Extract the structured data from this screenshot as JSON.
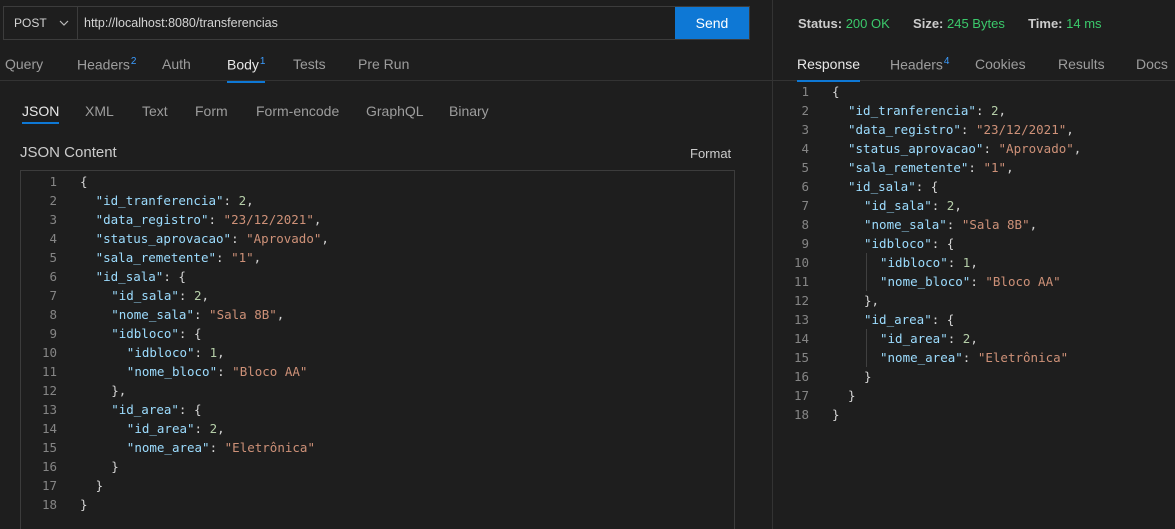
{
  "request": {
    "method": "POST",
    "url": "http://localhost:8080/transferencias",
    "send_label": "Send",
    "tabs": [
      {
        "label": "Query",
        "badge": ""
      },
      {
        "label": "Headers",
        "badge": "2"
      },
      {
        "label": "Auth",
        "badge": ""
      },
      {
        "label": "Body",
        "badge": "1"
      },
      {
        "label": "Tests",
        "badge": ""
      },
      {
        "label": "Pre Run",
        "badge": ""
      }
    ],
    "active_tab": "Body",
    "body_types": [
      "JSON",
      "XML",
      "Text",
      "Form",
      "Form-encode",
      "GraphQL",
      "Binary"
    ],
    "active_body_type": "JSON",
    "content_title": "JSON Content",
    "format_label": "Format"
  },
  "response": {
    "status_label": "Status:",
    "status_value": "200 OK",
    "size_label": "Size:",
    "size_value": "245 Bytes",
    "time_label": "Time:",
    "time_value": "14 ms",
    "tabs": [
      {
        "label": "Response",
        "badge": ""
      },
      {
        "label": "Headers",
        "badge": "4"
      },
      {
        "label": "Cookies",
        "badge": ""
      },
      {
        "label": "Results",
        "badge": ""
      },
      {
        "label": "Docs",
        "badge": ""
      }
    ],
    "active_tab": "Response"
  },
  "json_lines": [
    {
      "indent": 0,
      "parts": [
        [
          "p",
          "{"
        ]
      ]
    },
    {
      "indent": 1,
      "parts": [
        [
          "k",
          "\"id_tranferencia\""
        ],
        [
          "p",
          ": "
        ],
        [
          "n",
          "2"
        ],
        [
          "p",
          ","
        ]
      ]
    },
    {
      "indent": 1,
      "parts": [
        [
          "k",
          "\"data_registro\""
        ],
        [
          "p",
          ": "
        ],
        [
          "s",
          "\"23/12/2021\""
        ],
        [
          "p",
          ","
        ]
      ]
    },
    {
      "indent": 1,
      "parts": [
        [
          "k",
          "\"status_aprovacao\""
        ],
        [
          "p",
          ": "
        ],
        [
          "s",
          "\"Aprovado\""
        ],
        [
          "p",
          ","
        ]
      ]
    },
    {
      "indent": 1,
      "parts": [
        [
          "k",
          "\"sala_remetente\""
        ],
        [
          "p",
          ": "
        ],
        [
          "s",
          "\"1\""
        ],
        [
          "p",
          ","
        ]
      ]
    },
    {
      "indent": 1,
      "parts": [
        [
          "k",
          "\"id_sala\""
        ],
        [
          "p",
          ": {"
        ]
      ]
    },
    {
      "indent": 2,
      "parts": [
        [
          "k",
          "\"id_sala\""
        ],
        [
          "p",
          ": "
        ],
        [
          "n",
          "2"
        ],
        [
          "p",
          ","
        ]
      ]
    },
    {
      "indent": 2,
      "parts": [
        [
          "k",
          "\"nome_sala\""
        ],
        [
          "p",
          ": "
        ],
        [
          "s",
          "\"Sala 8B\""
        ],
        [
          "p",
          ","
        ]
      ]
    },
    {
      "indent": 2,
      "parts": [
        [
          "k",
          "\"idbloco\""
        ],
        [
          "p",
          ": {"
        ]
      ]
    },
    {
      "indent": 3,
      "parts": [
        [
          "k",
          "\"idbloco\""
        ],
        [
          "p",
          ": "
        ],
        [
          "n",
          "1"
        ],
        [
          "p",
          ","
        ]
      ]
    },
    {
      "indent": 3,
      "parts": [
        [
          "k",
          "\"nome_bloco\""
        ],
        [
          "p",
          ": "
        ],
        [
          "s",
          "\"Bloco AA\""
        ]
      ]
    },
    {
      "indent": 2,
      "parts": [
        [
          "p",
          "},"
        ]
      ]
    },
    {
      "indent": 2,
      "parts": [
        [
          "k",
          "\"id_area\""
        ],
        [
          "p",
          ": {"
        ]
      ]
    },
    {
      "indent": 3,
      "parts": [
        [
          "k",
          "\"id_area\""
        ],
        [
          "p",
          ": "
        ],
        [
          "n",
          "2"
        ],
        [
          "p",
          ","
        ]
      ]
    },
    {
      "indent": 3,
      "parts": [
        [
          "k",
          "\"nome_area\""
        ],
        [
          "p",
          ": "
        ],
        [
          "s",
          "\"Eletrônica\""
        ]
      ]
    },
    {
      "indent": 2,
      "parts": [
        [
          "p",
          "}"
        ]
      ]
    },
    {
      "indent": 1,
      "parts": [
        [
          "p",
          "}"
        ]
      ]
    },
    {
      "indent": 0,
      "parts": [
        [
          "p",
          "}"
        ]
      ]
    }
  ],
  "colors": {
    "accent": "#0e78d5",
    "status_ok": "#3bc96b",
    "json_key": "#9cdcfe",
    "json_string": "#ce9178",
    "json_number": "#b5cea8"
  }
}
